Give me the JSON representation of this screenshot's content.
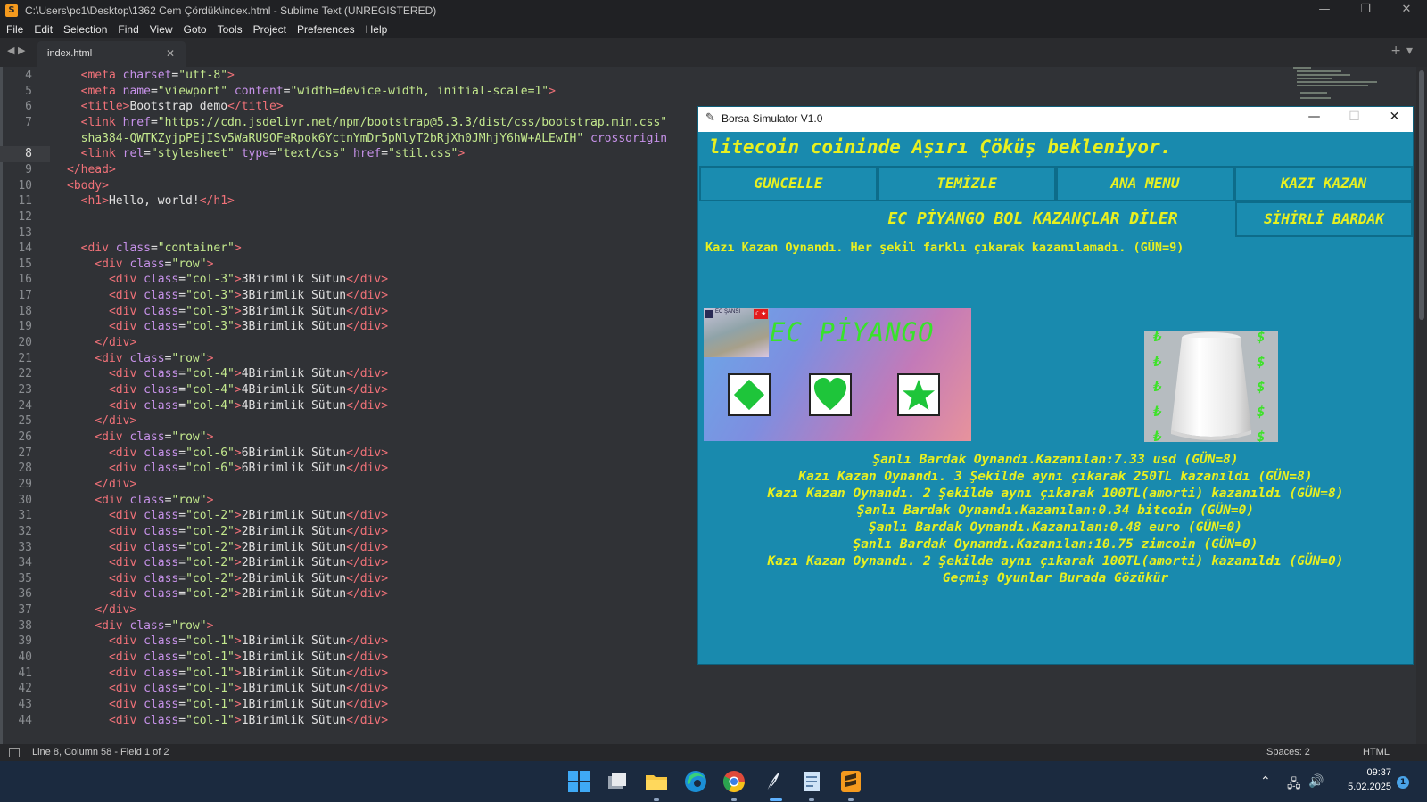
{
  "editor_window": {
    "title": "C:\\Users\\pc1\\Desktop\\1362 Cem Çördük\\index.html - Sublime Text (UNREGISTERED)",
    "menu": [
      "File",
      "Edit",
      "Selection",
      "Find",
      "View",
      "Goto",
      "Tools",
      "Project",
      "Preferences",
      "Help"
    ],
    "tab_label": "index.html",
    "status": {
      "position": "Line 8, Column 58 - Field 1 of 2",
      "spaces": "Spaces: 2",
      "syntax": "HTML"
    },
    "current_line": 8,
    "line_numbers": [
      "4",
      "5",
      "6",
      "7",
      "",
      "8",
      "9",
      "10",
      "11",
      "12",
      "13",
      "14",
      "15",
      "16",
      "17",
      "18",
      "19",
      "20",
      "21",
      "22",
      "23",
      "24",
      "25",
      "26",
      "27",
      "28",
      "29",
      "30",
      "31",
      "32",
      "33",
      "34",
      "35",
      "36",
      "37",
      "38",
      "39",
      "40",
      "41",
      "42",
      "43",
      "44"
    ],
    "code_lines": [
      [
        [
          "  ",
          "t"
        ],
        [
          "<meta ",
          "tag"
        ],
        [
          "charset",
          "attr"
        ],
        [
          "=",
          "t"
        ],
        [
          "\"utf-8\"",
          "str"
        ],
        [
          ">",
          "tag"
        ]
      ],
      [
        [
          "  ",
          "t"
        ],
        [
          "<meta ",
          "tag"
        ],
        [
          "name",
          "attr"
        ],
        [
          "=",
          "t"
        ],
        [
          "\"viewport\"",
          "str"
        ],
        [
          " ",
          "t"
        ],
        [
          "content",
          "attr"
        ],
        [
          "=",
          "t"
        ],
        [
          "\"width=device-width, initial-scale=1\"",
          "str"
        ],
        [
          ">",
          "tag"
        ]
      ],
      [
        [
          "  ",
          "t"
        ],
        [
          "<title>",
          "tag"
        ],
        [
          "Bootstrap demo",
          "t"
        ],
        [
          "</title>",
          "tag"
        ]
      ],
      [
        [
          "  ",
          "t"
        ],
        [
          "<link ",
          "tag"
        ],
        [
          "href",
          "attr"
        ],
        [
          "=",
          "t"
        ],
        [
          "\"https://cdn.jsdelivr.net/npm/bootstrap@5.3.3/dist/css/bootstrap.min.css\"",
          "str"
        ]
      ],
      [
        [
          "  ",
          "t"
        ],
        [
          "sha384-QWTKZyjpPEjISv5WaRU9OFeRpok6YctnYmDr5pNlyT2bRjXh0JMhjY6hW+ALEwIH\"",
          "str"
        ],
        [
          " ",
          "t"
        ],
        [
          "crossorigin",
          "attr"
        ]
      ],
      [
        [
          "  ",
          "t"
        ],
        [
          "<link ",
          "tag"
        ],
        [
          "rel",
          "attr"
        ],
        [
          "=",
          "t"
        ],
        [
          "\"stylesheet\"",
          "str"
        ],
        [
          " ",
          "t"
        ],
        [
          "type",
          "attr"
        ],
        [
          "=",
          "t"
        ],
        [
          "\"text/css\"",
          "str"
        ],
        [
          " ",
          "t"
        ],
        [
          "href",
          "attr"
        ],
        [
          "=",
          "t"
        ],
        [
          "\"stil.css\"",
          "str"
        ],
        [
          ">",
          "tag"
        ]
      ],
      [
        [
          "</head>",
          "tag"
        ]
      ],
      [
        [
          "<body>",
          "tag"
        ]
      ],
      [
        [
          "  ",
          "t"
        ],
        [
          "<h1>",
          "tag"
        ],
        [
          "Hello, world!",
          "t"
        ],
        [
          "</h1>",
          "tag"
        ]
      ],
      [],
      [],
      [
        [
          "  ",
          "t"
        ],
        [
          "<div ",
          "tag"
        ],
        [
          "class",
          "attr"
        ],
        [
          "=",
          "t"
        ],
        [
          "\"container\"",
          "str"
        ],
        [
          ">",
          "tag"
        ]
      ],
      [
        [
          "    ",
          "t"
        ],
        [
          "<div ",
          "tag"
        ],
        [
          "class",
          "attr"
        ],
        [
          "=",
          "t"
        ],
        [
          "\"row\"",
          "str"
        ],
        [
          ">",
          "tag"
        ]
      ],
      [
        [
          "      ",
          "t"
        ],
        [
          "<div ",
          "tag"
        ],
        [
          "class",
          "attr"
        ],
        [
          "=",
          "t"
        ],
        [
          "\"col-3\"",
          "str"
        ],
        [
          ">",
          "tag"
        ],
        [
          "3Birimlik Sütun",
          "t"
        ],
        [
          "</div>",
          "tag"
        ]
      ],
      [
        [
          "      ",
          "t"
        ],
        [
          "<div ",
          "tag"
        ],
        [
          "class",
          "attr"
        ],
        [
          "=",
          "t"
        ],
        [
          "\"col-3\"",
          "str"
        ],
        [
          ">",
          "tag"
        ],
        [
          "3Birimlik Sütun",
          "t"
        ],
        [
          "</div>",
          "tag"
        ]
      ],
      [
        [
          "      ",
          "t"
        ],
        [
          "<div ",
          "tag"
        ],
        [
          "class",
          "attr"
        ],
        [
          "=",
          "t"
        ],
        [
          "\"col-3\"",
          "str"
        ],
        [
          ">",
          "tag"
        ],
        [
          "3Birimlik Sütun",
          "t"
        ],
        [
          "</div>",
          "tag"
        ]
      ],
      [
        [
          "      ",
          "t"
        ],
        [
          "<div ",
          "tag"
        ],
        [
          "class",
          "attr"
        ],
        [
          "=",
          "t"
        ],
        [
          "\"col-3\"",
          "str"
        ],
        [
          ">",
          "tag"
        ],
        [
          "3Birimlik Sütun",
          "t"
        ],
        [
          "</div>",
          "tag"
        ]
      ],
      [
        [
          "    ",
          "t"
        ],
        [
          "</div>",
          "tag"
        ]
      ],
      [
        [
          "    ",
          "t"
        ],
        [
          "<div ",
          "tag"
        ],
        [
          "class",
          "attr"
        ],
        [
          "=",
          "t"
        ],
        [
          "\"row\"",
          "str"
        ],
        [
          ">",
          "tag"
        ]
      ],
      [
        [
          "      ",
          "t"
        ],
        [
          "<div ",
          "tag"
        ],
        [
          "class",
          "attr"
        ],
        [
          "=",
          "t"
        ],
        [
          "\"col-4\"",
          "str"
        ],
        [
          ">",
          "tag"
        ],
        [
          "4Birimlik Sütun",
          "t"
        ],
        [
          "</div>",
          "tag"
        ]
      ],
      [
        [
          "      ",
          "t"
        ],
        [
          "<div ",
          "tag"
        ],
        [
          "class",
          "attr"
        ],
        [
          "=",
          "t"
        ],
        [
          "\"col-4\"",
          "str"
        ],
        [
          ">",
          "tag"
        ],
        [
          "4Birimlik Sütun",
          "t"
        ],
        [
          "</div>",
          "tag"
        ]
      ],
      [
        [
          "      ",
          "t"
        ],
        [
          "<div ",
          "tag"
        ],
        [
          "class",
          "attr"
        ],
        [
          "=",
          "t"
        ],
        [
          "\"col-4\"",
          "str"
        ],
        [
          ">",
          "tag"
        ],
        [
          "4Birimlik Sütun",
          "t"
        ],
        [
          "</div>",
          "tag"
        ]
      ],
      [
        [
          "    ",
          "t"
        ],
        [
          "</div>",
          "tag"
        ]
      ],
      [
        [
          "    ",
          "t"
        ],
        [
          "<div ",
          "tag"
        ],
        [
          "class",
          "attr"
        ],
        [
          "=",
          "t"
        ],
        [
          "\"row\"",
          "str"
        ],
        [
          ">",
          "tag"
        ]
      ],
      [
        [
          "      ",
          "t"
        ],
        [
          "<div ",
          "tag"
        ],
        [
          "class",
          "attr"
        ],
        [
          "=",
          "t"
        ],
        [
          "\"col-6\"",
          "str"
        ],
        [
          ">",
          "tag"
        ],
        [
          "6Birimlik Sütun",
          "t"
        ],
        [
          "</div>",
          "tag"
        ]
      ],
      [
        [
          "      ",
          "t"
        ],
        [
          "<div ",
          "tag"
        ],
        [
          "class",
          "attr"
        ],
        [
          "=",
          "t"
        ],
        [
          "\"col-6\"",
          "str"
        ],
        [
          ">",
          "tag"
        ],
        [
          "6Birimlik Sütun",
          "t"
        ],
        [
          "</div>",
          "tag"
        ]
      ],
      [
        [
          "    ",
          "t"
        ],
        [
          "</div>",
          "tag"
        ]
      ],
      [
        [
          "    ",
          "t"
        ],
        [
          "<div ",
          "tag"
        ],
        [
          "class",
          "attr"
        ],
        [
          "=",
          "t"
        ],
        [
          "\"row\"",
          "str"
        ],
        [
          ">",
          "tag"
        ]
      ],
      [
        [
          "      ",
          "t"
        ],
        [
          "<div ",
          "tag"
        ],
        [
          "class",
          "attr"
        ],
        [
          "=",
          "t"
        ],
        [
          "\"col-2\"",
          "str"
        ],
        [
          ">",
          "tag"
        ],
        [
          "2Birimlik Sütun",
          "t"
        ],
        [
          "</div>",
          "tag"
        ]
      ],
      [
        [
          "      ",
          "t"
        ],
        [
          "<div ",
          "tag"
        ],
        [
          "class",
          "attr"
        ],
        [
          "=",
          "t"
        ],
        [
          "\"col-2\"",
          "str"
        ],
        [
          ">",
          "tag"
        ],
        [
          "2Birimlik Sütun",
          "t"
        ],
        [
          "</div>",
          "tag"
        ]
      ],
      [
        [
          "      ",
          "t"
        ],
        [
          "<div ",
          "tag"
        ],
        [
          "class",
          "attr"
        ],
        [
          "=",
          "t"
        ],
        [
          "\"col-2\"",
          "str"
        ],
        [
          ">",
          "tag"
        ],
        [
          "2Birimlik Sütun",
          "t"
        ],
        [
          "</div>",
          "tag"
        ]
      ],
      [
        [
          "      ",
          "t"
        ],
        [
          "<div ",
          "tag"
        ],
        [
          "class",
          "attr"
        ],
        [
          "=",
          "t"
        ],
        [
          "\"col-2\"",
          "str"
        ],
        [
          ">",
          "tag"
        ],
        [
          "2Birimlik Sütun",
          "t"
        ],
        [
          "</div>",
          "tag"
        ]
      ],
      [
        [
          "      ",
          "t"
        ],
        [
          "<div ",
          "tag"
        ],
        [
          "class",
          "attr"
        ],
        [
          "=",
          "t"
        ],
        [
          "\"col-2\"",
          "str"
        ],
        [
          ">",
          "tag"
        ],
        [
          "2Birimlik Sütun",
          "t"
        ],
        [
          "</div>",
          "tag"
        ]
      ],
      [
        [
          "      ",
          "t"
        ],
        [
          "<div ",
          "tag"
        ],
        [
          "class",
          "attr"
        ],
        [
          "=",
          "t"
        ],
        [
          "\"col-2\"",
          "str"
        ],
        [
          ">",
          "tag"
        ],
        [
          "2Birimlik Sütun",
          "t"
        ],
        [
          "</div>",
          "tag"
        ]
      ],
      [
        [
          "    ",
          "t"
        ],
        [
          "</div>",
          "tag"
        ]
      ],
      [
        [
          "    ",
          "t"
        ],
        [
          "<div ",
          "tag"
        ],
        [
          "class",
          "attr"
        ],
        [
          "=",
          "t"
        ],
        [
          "\"row\"",
          "str"
        ],
        [
          ">",
          "tag"
        ]
      ],
      [
        [
          "      ",
          "t"
        ],
        [
          "<div ",
          "tag"
        ],
        [
          "class",
          "attr"
        ],
        [
          "=",
          "t"
        ],
        [
          "\"col-1\"",
          "str"
        ],
        [
          ">",
          "tag"
        ],
        [
          "1Birimlik Sütun",
          "t"
        ],
        [
          "</div>",
          "tag"
        ]
      ],
      [
        [
          "      ",
          "t"
        ],
        [
          "<div ",
          "tag"
        ],
        [
          "class",
          "attr"
        ],
        [
          "=",
          "t"
        ],
        [
          "\"col-1\"",
          "str"
        ],
        [
          ">",
          "tag"
        ],
        [
          "1Birimlik Sütun",
          "t"
        ],
        [
          "</div>",
          "tag"
        ]
      ],
      [
        [
          "      ",
          "t"
        ],
        [
          "<div ",
          "tag"
        ],
        [
          "class",
          "attr"
        ],
        [
          "=",
          "t"
        ],
        [
          "\"col-1\"",
          "str"
        ],
        [
          ">",
          "tag"
        ],
        [
          "1Birimlik Sütun",
          "t"
        ],
        [
          "</div>",
          "tag"
        ]
      ],
      [
        [
          "      ",
          "t"
        ],
        [
          "<div ",
          "tag"
        ],
        [
          "class",
          "attr"
        ],
        [
          "=",
          "t"
        ],
        [
          "\"col-1\"",
          "str"
        ],
        [
          ">",
          "tag"
        ],
        [
          "1Birimlik Sütun",
          "t"
        ],
        [
          "</div>",
          "tag"
        ]
      ],
      [
        [
          "      ",
          "t"
        ],
        [
          "<div ",
          "tag"
        ],
        [
          "class",
          "attr"
        ],
        [
          "=",
          "t"
        ],
        [
          "\"col-1\"",
          "str"
        ],
        [
          ">",
          "tag"
        ],
        [
          "1Birimlik Sütun",
          "t"
        ],
        [
          "</div>",
          "tag"
        ]
      ],
      [
        [
          "      ",
          "t"
        ],
        [
          "<div ",
          "tag"
        ],
        [
          "class",
          "attr"
        ],
        [
          "=",
          "t"
        ],
        [
          "\"col-1\"",
          "str"
        ],
        [
          ">",
          "tag"
        ],
        [
          "1Birimlik Sütun",
          "t"
        ],
        [
          "</div>",
          "tag"
        ]
      ]
    ]
  },
  "borsa": {
    "title": "Borsa Simulator V1.0",
    "headline": "litecoin coininde Aşırı Çöküş bekleniyor.",
    "buttons": [
      "GUNCELLE",
      "TEMİZLE",
      "ANA MENU",
      "KAZI KAZAN"
    ],
    "banner": "EC PİYANGO BOL KAZANÇLAR DİLER",
    "magic_button": "SİHİRLİ BARDAK",
    "info": "Kazı Kazan Oynandı. Her şekil farklı çıkarak kazanılamadı. (GÜN=9)",
    "lottery_title": "EC PİYANGO",
    "lottery_logo_text": "EC ŞANSI",
    "lottery_shapes": [
      "diamond-icon",
      "heart-icon",
      "star-icon"
    ],
    "cup_symbols_left": [
      "₺",
      "₺",
      "₺",
      "₺",
      "₺"
    ],
    "cup_symbols_right": [
      "$",
      "$",
      "$",
      "$",
      "$"
    ],
    "history": [
      "Şanlı Bardak Oynandı.Kazanılan:7.33 usd (GÜN=8)",
      "Kazı Kazan Oynandı. 3 Şekilde aynı çıkarak 250TL kazanıldı (GÜN=8)",
      "Kazı Kazan Oynandı. 2 Şekilde aynı çıkarak 100TL(amorti) kazanıldı (GÜN=8)",
      "Şanlı Bardak Oynandı.Kazanılan:0.34 bitcoin (GÜN=0)",
      "Şanlı Bardak Oynandı.Kazanılan:0.48 euro (GÜN=0)",
      "Şanlı Bardak Oynandı.Kazanılan:10.75 zimcoin (GÜN=0)",
      "Kazı Kazan Oynandı. 2 Şekilde aynı çıkarak 100TL(amorti) kazanıldı (GÜN=0)",
      "Geçmiş Oyunlar Burada Gözükür"
    ],
    "colors": {
      "background": "#198aae",
      "text": "#e8f020",
      "lottery_text": "#39e22b"
    }
  },
  "taskbar": {
    "time": "09:37",
    "date": "5.02.2025",
    "notification_count": "1",
    "apps": [
      "windows-start-icon",
      "task-view-icon",
      "file-explorer-icon",
      "edge-icon",
      "chrome-icon",
      "python-feather-icon",
      "notepad-icon",
      "sublime-text-icon"
    ]
  }
}
